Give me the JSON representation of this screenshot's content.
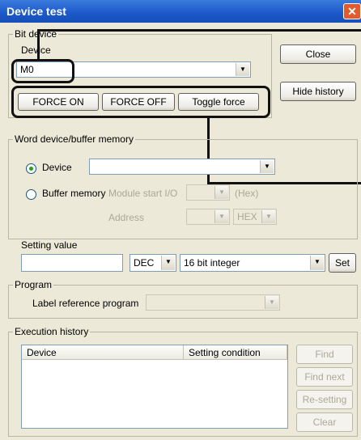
{
  "window": {
    "title": "Device test",
    "close_glyph": "✕"
  },
  "bit_device": {
    "legend": "Bit device",
    "device_label": "Device",
    "device_value": "M0",
    "force_on_label": "FORCE ON",
    "force_off_label": "FORCE OFF",
    "toggle_force_label": "Toggle force"
  },
  "side_buttons": {
    "close_label": "Close",
    "hide_history_label": "Hide history"
  },
  "word_device": {
    "legend": "Word device/buffer memory",
    "device_radio_label": "Device",
    "device_value": "",
    "buffer_radio_label": "Buffer memory",
    "selected": "device",
    "module_start_label": "Module start I/O",
    "hex_unit": "(Hex)",
    "address_label": "Address",
    "address_format": "HEX"
  },
  "setting_value": {
    "legend": "Setting value",
    "value": "",
    "radix": "DEC",
    "data_type": "16 bit integer",
    "set_label": "Set"
  },
  "program": {
    "legend": "Program",
    "label_ref_label": "Label reference program",
    "value": ""
  },
  "execution_history": {
    "legend": "Execution history",
    "columns": [
      "Device",
      "Setting condition"
    ],
    "find_label": "Find",
    "find_next_label": "Find next",
    "resetting_label": "Re-setting",
    "clear_label": "Clear"
  },
  "icons": {
    "dropdown": "▼"
  }
}
